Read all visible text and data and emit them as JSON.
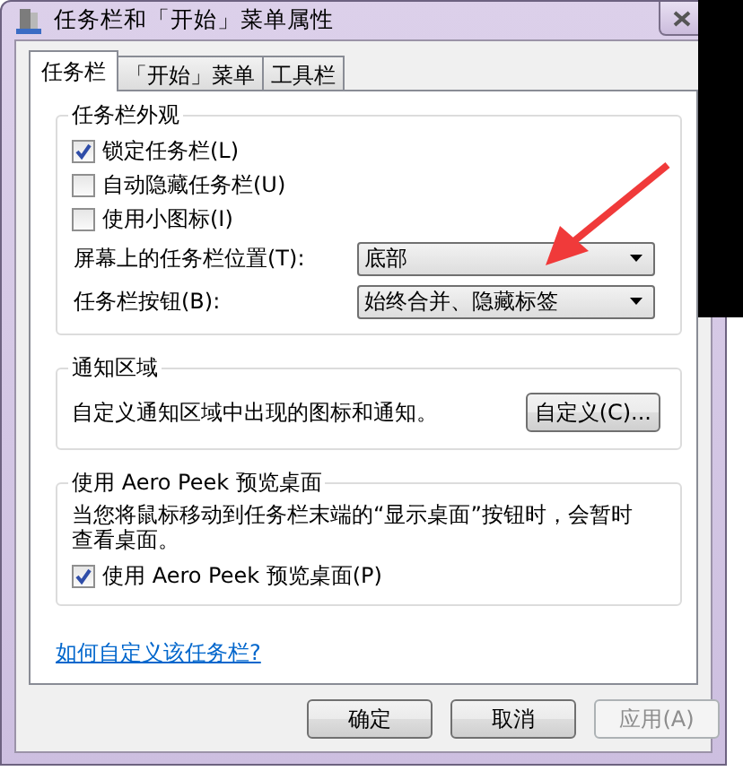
{
  "window": {
    "title": "任务栏和「开始」菜单属性"
  },
  "tabs": [
    {
      "label": "任务栏",
      "selected": true
    },
    {
      "label": "「开始」菜单",
      "selected": false
    },
    {
      "label": "工具栏",
      "selected": false
    }
  ],
  "appearance": {
    "title": "任务栏外观",
    "checkboxes": [
      {
        "label": "锁定任务栏(L)",
        "checked": true
      },
      {
        "label": "自动隐藏任务栏(U)",
        "checked": false
      },
      {
        "label": "使用小图标(I)",
        "checked": false
      }
    ],
    "dropdowns": [
      {
        "label": "屏幕上的任务栏位置(T):",
        "value": "底部"
      },
      {
        "label": "任务栏按钮(B):",
        "value": "始终合并、隐藏标签"
      }
    ]
  },
  "notification_area": {
    "title": "通知区域",
    "text": "自定义通知区域中出现的图标和通知。",
    "button": "自定义(C)..."
  },
  "aero_peek": {
    "title": "使用 Aero Peek 预览桌面",
    "text": "当您将鼠标移动到任务栏末端的“显示桌面”按钮时，会暂时查看桌面。",
    "checkbox": {
      "label": "使用 Aero Peek 预览桌面(P)",
      "checked": true
    }
  },
  "help_link": "如何自定义该任务栏?",
  "buttons": [
    {
      "label": "确定",
      "disabled": false
    },
    {
      "label": "取消",
      "disabled": false
    },
    {
      "label": "应用(A)",
      "disabled": true
    }
  ]
}
